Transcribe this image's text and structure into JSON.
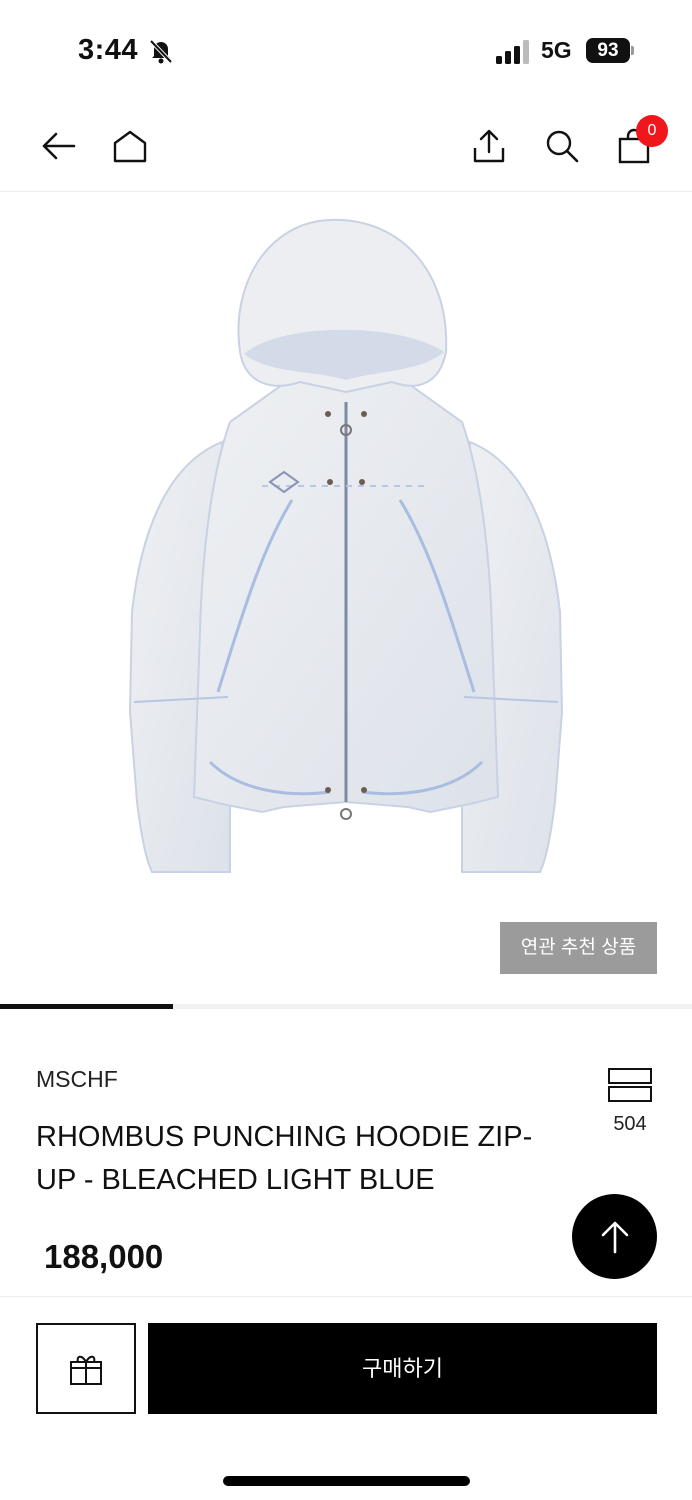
{
  "status_bar": {
    "time": "3:44",
    "network": "5G",
    "battery": "93",
    "icons": [
      "bell-off-icon",
      "signal-icon",
      "battery-icon"
    ]
  },
  "nav": {
    "icons": [
      "back-arrow-icon",
      "home-icon",
      "share-icon",
      "search-icon",
      "shopping-bag-icon"
    ],
    "cart_count": "0"
  },
  "product": {
    "related_label": "연관 추천 상품",
    "gallery_progress": 0.25,
    "brand": "MSCHF",
    "title": "RHOMBUS PUNCHING HOODIE ZIP-UP - BLEACHED LIGHT BLUE",
    "wish_count": "504",
    "price": "188,000"
  },
  "bottom_bar": {
    "buy_label": "구매하기",
    "icons": [
      "gift-icon",
      "arrow-up-icon"
    ]
  },
  "colors": {
    "accent": "#000000",
    "badge": "#f0171c",
    "related_button": "#9b9b9b"
  }
}
